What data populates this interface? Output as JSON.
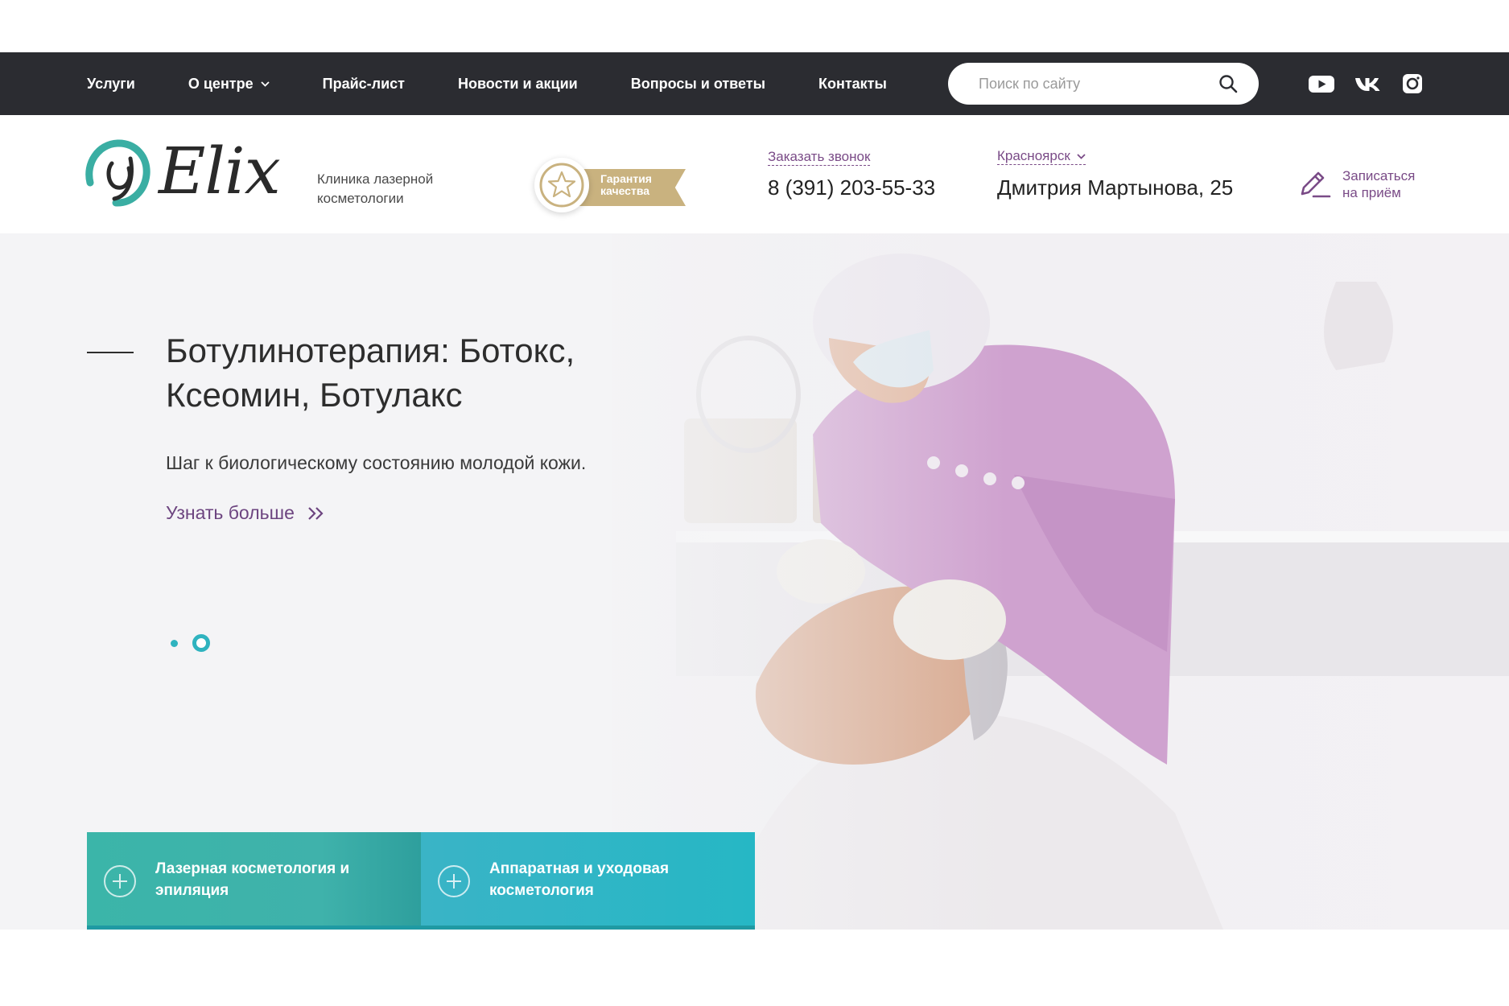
{
  "topnav": {
    "items": [
      {
        "label": "Услуги"
      },
      {
        "label": "О центре",
        "has_dropdown": true
      },
      {
        "label": "Прайс-лист"
      },
      {
        "label": "Новости и акции"
      },
      {
        "label": "Вопросы и ответы"
      },
      {
        "label": "Контакты"
      }
    ],
    "search_placeholder": "Поиск по сайту",
    "social": [
      "youtube-icon",
      "vk-icon",
      "instagram-icon"
    ]
  },
  "header": {
    "logo": "Elix",
    "tagline_line1": "Клиника лазерной",
    "tagline_line2": "косметологии",
    "badge_line1": "Гарантия",
    "badge_line2": "качества",
    "callback_label": "Заказать звонок",
    "phone": "8 (391) 203-55-33",
    "city": "Красноярск",
    "address": "Дмитрия Мартынова, 25",
    "appointment_line1": "Записаться",
    "appointment_line2": "на приём"
  },
  "hero": {
    "title_line1": "Ботулинотерапия: Ботокс,",
    "title_line2": "Ксеомин, Ботулакс",
    "subtitle": "Шаг к биологическому состоянию молодой кожи.",
    "more_link": "Узнать больше",
    "slides_total": 2,
    "active_slide": 2
  },
  "categories": [
    {
      "line1": "Лазерная косметология и",
      "line2": "эпиляция"
    },
    {
      "line1": "Аппаратная и уходовая",
      "line2": "косметология"
    }
  ],
  "colors": {
    "topbar": "#2b2c31",
    "accent_purple": "#7a4b87",
    "accent_teal": "#2fb3bf",
    "badge_gold": "#c9b27f"
  }
}
